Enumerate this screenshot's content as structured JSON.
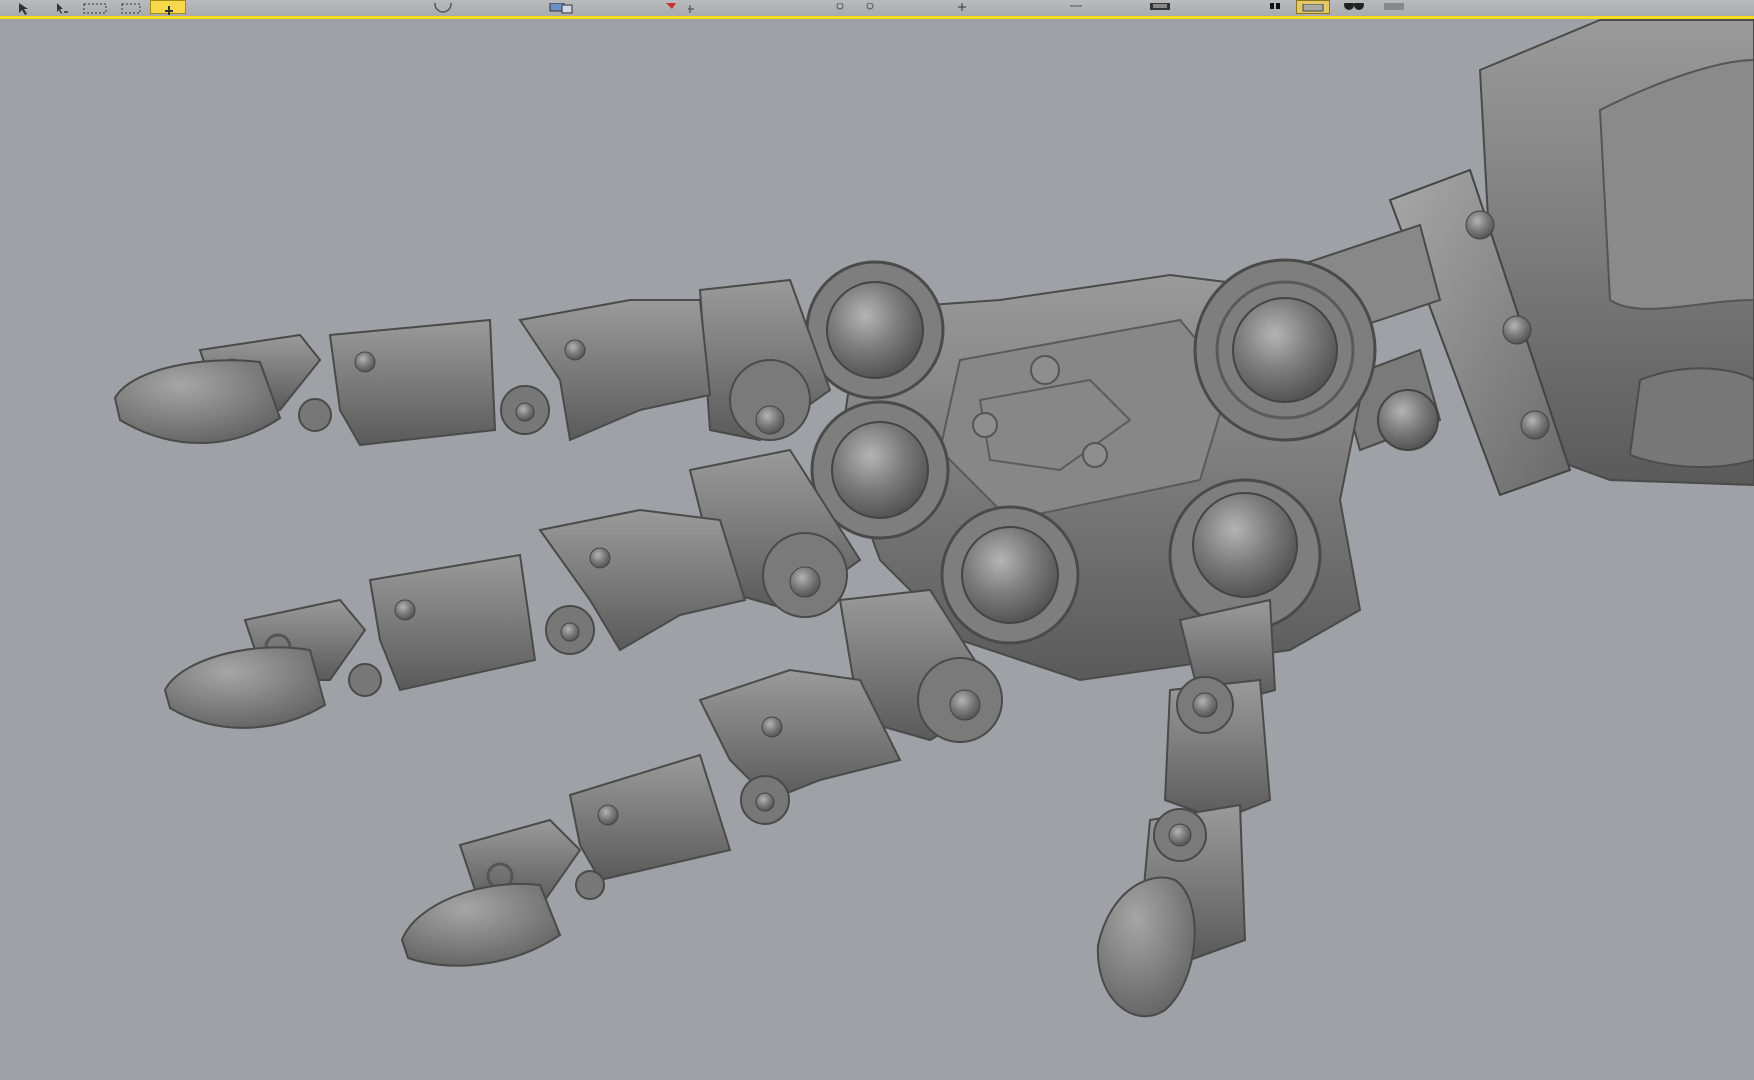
{
  "app": {
    "type": "3d-modeling-viewport"
  },
  "toolbar": {
    "accent_color": "#f2dc1c",
    "tools": [
      {
        "name": "select-object-tool",
        "icon": "arrow-cursor-icon"
      },
      {
        "name": "select-by-name-tool",
        "icon": "arrow-list-icon"
      },
      {
        "name": "rectangular-selection-tool",
        "icon": "dashed-rectangle-icon"
      },
      {
        "name": "window-crossing-tool",
        "icon": "window-select-icon"
      },
      {
        "name": "select-and-move-tool",
        "icon": "move-icon",
        "active": true
      },
      {
        "name": "select-and-rotate-tool",
        "icon": "rotate-icon"
      },
      {
        "name": "select-and-scale-tool",
        "icon": "scale-icon"
      },
      {
        "name": "snap-toggle-tool",
        "icon": "magnet-icon"
      },
      {
        "name": "percent-snap-tool",
        "icon": "percent-icon"
      },
      {
        "name": "mirror-tool",
        "icon": "mirror-icon"
      },
      {
        "name": "align-tool",
        "icon": "align-icon"
      },
      {
        "name": "render-frame-tool",
        "icon": "render-frame-icon"
      },
      {
        "name": "layer-manager-tool",
        "icon": "layers-icon"
      },
      {
        "name": "material-editor-tool",
        "icon": "material-editor-icon",
        "active": true
      },
      {
        "name": "render-setup-tool",
        "icon": "teapot-icon"
      },
      {
        "name": "render-tool",
        "icon": "render-icon"
      }
    ]
  },
  "viewport": {
    "background_color": "#9ea1a6",
    "model_color": "#7d7d7d",
    "model": "mechanical-robot-hand"
  }
}
